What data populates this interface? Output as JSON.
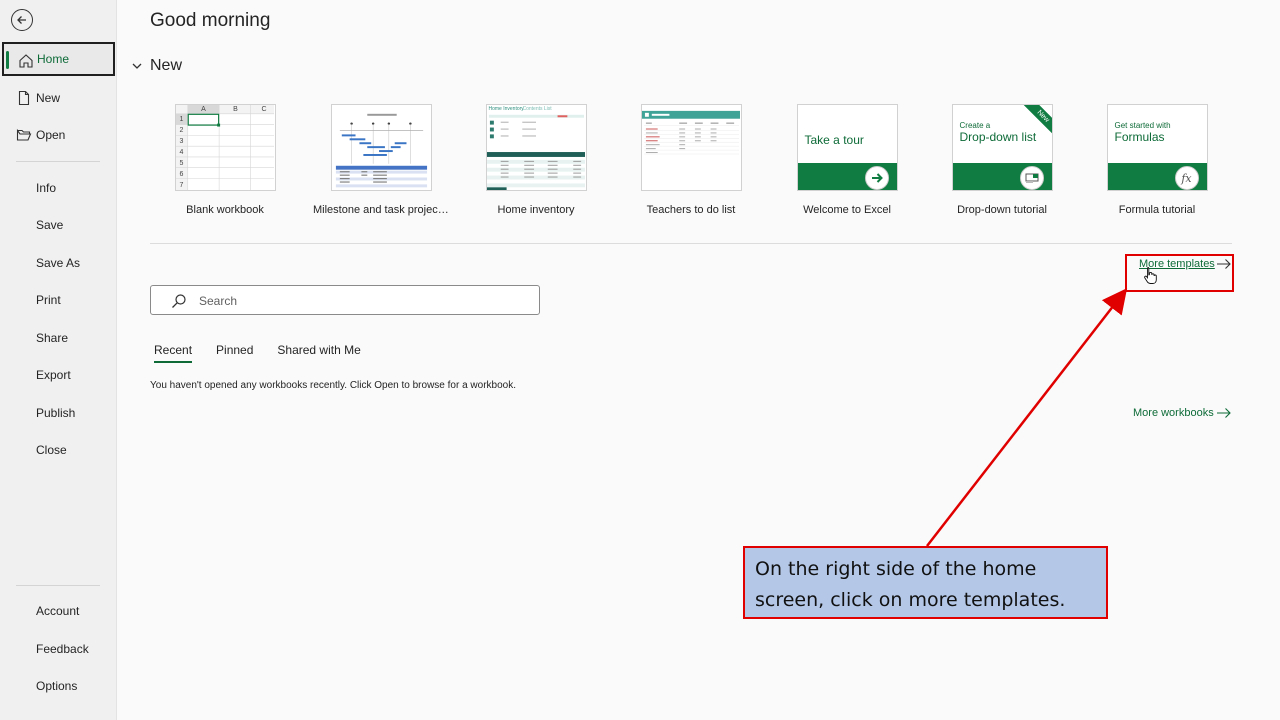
{
  "sidebar": {
    "nav_top": [
      {
        "label": "Home",
        "icon": "home-icon"
      },
      {
        "label": "New",
        "icon": "new-file-icon"
      },
      {
        "label": "Open",
        "icon": "open-folder-icon"
      }
    ],
    "nav_middle": [
      "Info",
      "Save",
      "Save As",
      "Print",
      "Share",
      "Export",
      "Publish",
      "Close"
    ],
    "nav_bottom": [
      "Account",
      "Feedback",
      "Options"
    ]
  },
  "main": {
    "greeting": "Good morning",
    "new_section_title": "New",
    "templates": [
      {
        "label": "Blank workbook",
        "thumb": "blank"
      },
      {
        "label": "Milestone and task project t...",
        "thumb": "milestone"
      },
      {
        "label": "Home inventory",
        "thumb": "inventory"
      },
      {
        "label": "Teachers to do list",
        "thumb": "teachers"
      },
      {
        "label": "Welcome to Excel",
        "thumb": "tour",
        "thumb_text": "Take a tour"
      },
      {
        "label": "Drop-down tutorial",
        "thumb": "dropdown",
        "thumb_small": "Create a",
        "thumb_text": "Drop-down list",
        "badge": "New"
      },
      {
        "label": "Formula tutorial",
        "thumb": "formula",
        "thumb_small": "Get started with",
        "thumb_text": "Formulas",
        "symbol": "fx"
      }
    ],
    "blank_grid": {
      "columns": [
        "A",
        "B",
        "C"
      ],
      "rows": [
        "1",
        "2",
        "3",
        "4",
        "5",
        "6",
        "7"
      ]
    },
    "inventory_thumb": {
      "title": "Home Inventory",
      "tab": "Contents List"
    },
    "more_templates": "More templates",
    "search": {
      "placeholder": "Search"
    },
    "tabs": [
      "Recent",
      "Pinned",
      "Shared with Me"
    ],
    "empty_message": "You haven't opened any workbooks recently. Click Open to browse for a workbook.",
    "more_workbooks": "More workbooks"
  },
  "callout": {
    "text": "On the right side of the home screen, click on more templates."
  },
  "colors": {
    "accent_green": "#107c41",
    "link_green": "#0e6b38",
    "highlight_red": "#e00000",
    "callout_fill": "#b4c7e7"
  }
}
